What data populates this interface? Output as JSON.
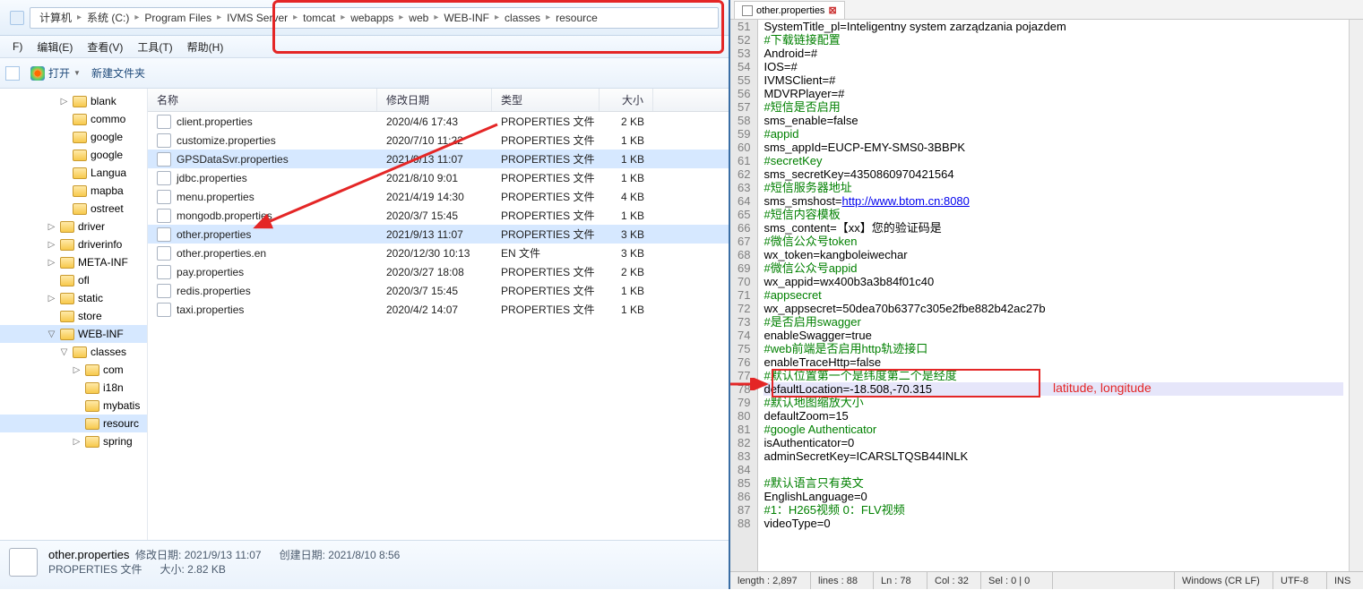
{
  "breadcrumb": [
    "计算机",
    "系统 (C:)",
    "Program Files",
    "IVMS Server",
    "tomcat",
    "webapps",
    "web",
    "WEB-INF",
    "classes",
    "resource"
  ],
  "menu": {
    "file": "F)",
    "edit": "编辑(E)",
    "view": "查看(V)",
    "tools": "工具(T)",
    "help": "帮助(H)"
  },
  "toolbar": {
    "open": "打开",
    "new": "新建文件夹"
  },
  "tree": [
    {
      "indent": 66,
      "label": "blank",
      "exp": "▷"
    },
    {
      "indent": 66,
      "label": "commo",
      "exp": ""
    },
    {
      "indent": 66,
      "label": "google",
      "exp": ""
    },
    {
      "indent": 66,
      "label": "google",
      "exp": ""
    },
    {
      "indent": 66,
      "label": "Langua",
      "exp": ""
    },
    {
      "indent": 66,
      "label": "mapba",
      "exp": ""
    },
    {
      "indent": 66,
      "label": "ostreet",
      "exp": ""
    },
    {
      "indent": 52,
      "label": "driver",
      "exp": "▷"
    },
    {
      "indent": 52,
      "label": "driverinfo",
      "exp": "▷"
    },
    {
      "indent": 52,
      "label": "META-INF",
      "exp": "▷"
    },
    {
      "indent": 52,
      "label": "ofl",
      "exp": ""
    },
    {
      "indent": 52,
      "label": "static",
      "exp": "▷"
    },
    {
      "indent": 52,
      "label": "store",
      "exp": ""
    },
    {
      "indent": 52,
      "label": "WEB-INF",
      "exp": "▽",
      "sel": true
    },
    {
      "indent": 66,
      "label": "classes",
      "exp": "▽"
    },
    {
      "indent": 80,
      "label": "com",
      "exp": "▷"
    },
    {
      "indent": 80,
      "label": "i18n",
      "exp": ""
    },
    {
      "indent": 80,
      "label": "mybatis",
      "exp": ""
    },
    {
      "indent": 80,
      "label": "resourc",
      "exp": "",
      "sel": true
    },
    {
      "indent": 80,
      "label": "spring",
      "exp": "▷"
    }
  ],
  "cols": {
    "name": "名称",
    "date": "修改日期",
    "type": "类型",
    "size": "大小"
  },
  "files": [
    {
      "n": "client.properties",
      "d": "2020/4/6 17:43",
      "t": "PROPERTIES 文件",
      "s": "2 KB"
    },
    {
      "n": "customize.properties",
      "d": "2020/7/10 11:22",
      "t": "PROPERTIES 文件",
      "s": "1 KB"
    },
    {
      "n": "GPSDataSvr.properties",
      "d": "2021/9/13 11:07",
      "t": "PROPERTIES 文件",
      "s": "1 KB",
      "sel": true
    },
    {
      "n": "jdbc.properties",
      "d": "2021/8/10 9:01",
      "t": "PROPERTIES 文件",
      "s": "1 KB"
    },
    {
      "n": "menu.properties",
      "d": "2021/4/19 14:30",
      "t": "PROPERTIES 文件",
      "s": "4 KB"
    },
    {
      "n": "mongodb.properties",
      "d": "2020/3/7 15:45",
      "t": "PROPERTIES 文件",
      "s": "1 KB"
    },
    {
      "n": "other.properties",
      "d": "2021/9/13 11:07",
      "t": "PROPERTIES 文件",
      "s": "3 KB",
      "sel": true
    },
    {
      "n": "other.properties.en",
      "d": "2020/12/30 10:13",
      "t": "EN 文件",
      "s": "3 KB"
    },
    {
      "n": "pay.properties",
      "d": "2020/3/27 18:08",
      "t": "PROPERTIES 文件",
      "s": "2 KB"
    },
    {
      "n": "redis.properties",
      "d": "2020/3/7 15:45",
      "t": "PROPERTIES 文件",
      "s": "1 KB"
    },
    {
      "n": "taxi.properties",
      "d": "2020/4/2 14:07",
      "t": "PROPERTIES 文件",
      "s": "1 KB"
    }
  ],
  "details": {
    "name": "other.properties",
    "mdLabel": "修改日期:",
    "md": "2021/9/13 11:07",
    "cdLabel": "创建日期:",
    "cd": "2021/8/10 8:56",
    "typeLabel": "PROPERTIES 文件",
    "szLabel": "大小:",
    "sz": "2.82 KB"
  },
  "tab": {
    "name": "other.properties"
  },
  "lines": [
    {
      "n": 51,
      "t": "SystemTitle_pl=Inteligentny system zarządzania pojazdem"
    },
    {
      "n": 52,
      "t": "#下载链接配置",
      "c": true
    },
    {
      "n": 53,
      "t": "Android=#"
    },
    {
      "n": 54,
      "t": "IOS=#"
    },
    {
      "n": 55,
      "t": "IVMSClient=#"
    },
    {
      "n": 56,
      "t": "MDVRPlayer=#"
    },
    {
      "n": 57,
      "t": "#短信是否启用",
      "c": true
    },
    {
      "n": 58,
      "t": "sms_enable=false"
    },
    {
      "n": 59,
      "t": "#appid",
      "c": true
    },
    {
      "n": 60,
      "t": "sms_appId=EUCP-EMY-SMS0-3BBPK"
    },
    {
      "n": 61,
      "t": "#secretKey",
      "c": true
    },
    {
      "n": 62,
      "t": "sms_secretKey=4350860970421564"
    },
    {
      "n": 63,
      "t": "#短信服务器地址",
      "c": true
    },
    {
      "n": 64,
      "t": "sms_smshost=http://www.btom.cn:8080",
      "u": true
    },
    {
      "n": 65,
      "t": "#短信内容模板",
      "c": true
    },
    {
      "n": 66,
      "t": "sms_content=【xx】您的验证码是"
    },
    {
      "n": 67,
      "t": "#微信公众号token",
      "c": true
    },
    {
      "n": 68,
      "t": "wx_token=kangboleiwechar"
    },
    {
      "n": 69,
      "t": "#微信公众号appid",
      "c": true
    },
    {
      "n": 70,
      "t": "wx_appid=wx400b3a3b84f01c40"
    },
    {
      "n": 71,
      "t": "#appsecret",
      "c": true
    },
    {
      "n": 72,
      "t": "wx_appsecret=50dea70b6377c305e2fbe882b42ac27b"
    },
    {
      "n": 73,
      "t": "#是否启用swagger",
      "c": true
    },
    {
      "n": 74,
      "t": "enableSwagger=true"
    },
    {
      "n": 75,
      "t": "#web前端是否启用http轨迹接口",
      "c": true
    },
    {
      "n": 76,
      "t": "enableTraceHttp=false"
    },
    {
      "n": 77,
      "t": "#默认位置第一个是纬度第二个是经度",
      "c": true
    },
    {
      "n": 78,
      "t": "defaultLocation=-18.508,-70.315",
      "hl": true
    },
    {
      "n": 79,
      "t": "#默认地图缩放大小",
      "c": true
    },
    {
      "n": 80,
      "t": "defaultZoom=15"
    },
    {
      "n": 81,
      "t": "#google Authenticator",
      "c": true
    },
    {
      "n": 82,
      "t": "isAuthenticator=0"
    },
    {
      "n": 83,
      "t": "adminSecretKey=ICARSLTQSB44INLK"
    },
    {
      "n": 84,
      "t": ""
    },
    {
      "n": 85,
      "t": "#默认语言只有英文",
      "c": true
    },
    {
      "n": 86,
      "t": "EnglishLanguage=0"
    },
    {
      "n": 87,
      "t": "#1：H265视频 0：FLV视频",
      "c": true
    },
    {
      "n": 88,
      "t": "videoType=0"
    }
  ],
  "status": {
    "len": "length : 2,897",
    "lines": "lines : 88",
    "ln": "Ln : 78",
    "col": "Col : 32",
    "sel": "Sel : 0 | 0",
    "eol": "Windows (CR LF)",
    "enc": "UTF-8",
    "mode": "INS"
  },
  "annotation": {
    "label": "latitude, longitude"
  }
}
